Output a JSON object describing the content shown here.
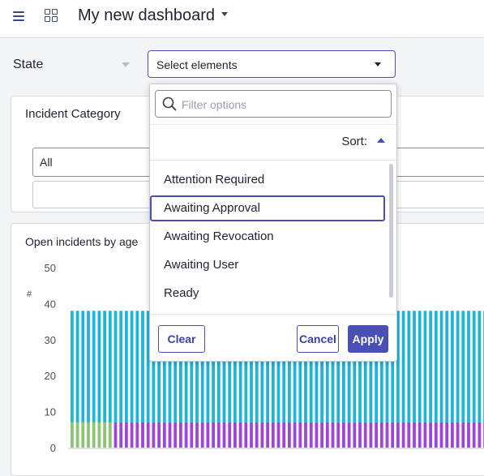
{
  "header": {
    "title": "My new dashboard"
  },
  "filters": {
    "state_label": "State",
    "state_select_text": "Select elements",
    "incident_category_title": "Incident Category",
    "incident_category_value": "All"
  },
  "popup": {
    "filter_placeholder": "Filter options",
    "sort_label": "Sort:",
    "options": [
      "Attention Required",
      "Awaiting Approval",
      "Awaiting Revocation",
      "Awaiting User",
      "Ready"
    ],
    "focused_option": "Awaiting Approval",
    "clear_label": "Clear",
    "cancel_label": "Cancel",
    "apply_label": "Apply"
  },
  "chart": {
    "title": "Open incidents by age"
  },
  "chart_data": {
    "type": "bar",
    "stacked": true,
    "ylabel": "#",
    "ylim": [
      0,
      50
    ],
    "yticks": [
      "50",
      "40",
      "30",
      "20",
      "10",
      "0"
    ],
    "series": [
      {
        "color": "#8cc474",
        "note": "first 8 bars only",
        "values_first_bars": 7
      },
      {
        "color": "#a045d8",
        "value_per_bar": 7
      },
      {
        "color": "#1fb5d5",
        "value_per_bar": 31
      }
    ],
    "bar_total": 38,
    "colors": {
      "green": "#8cc474",
      "purple": "#a045d8",
      "cyan": "#1fb5d5"
    }
  }
}
